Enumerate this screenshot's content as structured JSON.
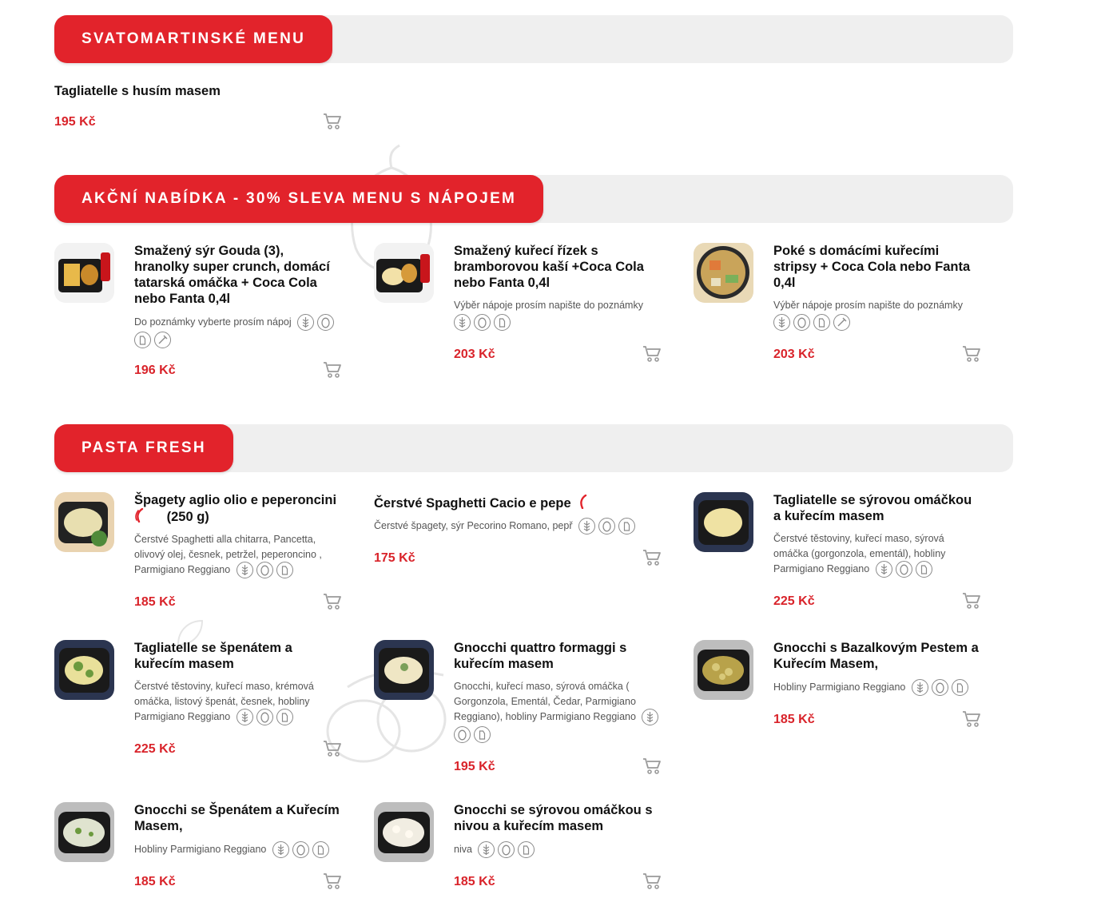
{
  "sections": [
    {
      "title": "SVATOMARTINSKÉ MENU",
      "items": [
        {
          "name": "Tagliatelle s husím masem",
          "price": "195 Kč",
          "image": false
        }
      ]
    },
    {
      "title": "AKČNÍ NABÍDKA - 30% SLEVA MENU S NÁPOJEM",
      "items": [
        {
          "name": "Smažený sýr Gouda (3), hranolky super crunch, domácí tatarská omáčka + Coca Cola nebo Fanta 0,4l",
          "desc": "Do poznámky vyberte prosím nápoj",
          "price": "196 Kč",
          "allergens": [
            "gluten-icon",
            "egg-icon",
            "milk-icon",
            "mustard-icon"
          ]
        },
        {
          "name": "Smažený kuřecí řízek s bramborovou kaší +Coca Cola nebo Fanta 0,4l",
          "desc": "Výběr nápoje prosím napište do poznámky",
          "price": "203 Kč",
          "allergens": [
            "gluten-icon",
            "egg-icon",
            "milk-icon"
          ]
        },
        {
          "name": "Poké s domácími kuřecími stripsy + Coca Cola nebo Fanta 0,4l",
          "desc": "Výběr nápoje prosím napište do poznámky",
          "price": "203 Kč",
          "allergens": [
            "gluten-icon",
            "egg-icon",
            "milk-icon",
            "mustard-icon"
          ]
        }
      ]
    },
    {
      "title": "PASTA FRESH",
      "items": [
        {
          "name": "Špagety aglio olio e peperoncini",
          "name_suffix": "(250 g)",
          "desc": "Čerstvé Spaghetti alla chitarra, Pancetta, olivový olej, česnek, petržel, peperoncino , Parmigiano Reggiano",
          "price": "185 Kč",
          "allergens": [
            "gluten-icon",
            "egg-icon",
            "milk-icon"
          ]
        },
        {
          "name": "Čerstvé Spaghetti Cacio e pepe",
          "desc": "Čerstvé špagety, sýr Pecorino Romano, pepř",
          "price": "175 Kč",
          "allergens": [
            "gluten-icon",
            "egg-icon",
            "milk-icon"
          ]
        },
        {
          "name": "Tagliatelle se sýrovou omáčkou a kuřecím masem",
          "desc": "Čerstvé těstoviny, kuřecí maso, sýrová omáčka (gorgonzola, ementál), hobliny Parmigiano Reggiano",
          "price": "225 Kč",
          "allergens": [
            "gluten-icon",
            "egg-icon",
            "milk-icon"
          ]
        },
        {
          "name": "Tagliatelle se špenátem a kuřecím masem",
          "desc": "Čerstvé těstoviny, kuřecí maso, krémová omáčka, listový špenát, česnek, hobliny Parmigiano Reggiano",
          "price": "225 Kč",
          "allergens": [
            "gluten-icon",
            "egg-icon",
            "milk-icon"
          ]
        },
        {
          "name": "Gnocchi quattro formaggi s kuřecím masem",
          "desc": "Gnocchi, kuřecí maso, sýrová omáčka ( Gorgonzola, Ementál, Čedar, Parmigiano Reggiano), hobliny Parmigiano Reggiano",
          "price": "195 Kč",
          "allergens": [
            "gluten-icon",
            "egg-icon",
            "milk-icon"
          ]
        },
        {
          "name": "Gnocchi s Bazalkovým Pestem a Kuřecím Masem,",
          "desc": "Hobliny Parmigiano Reggiano",
          "price": "185 Kč",
          "allergens": [
            "gluten-icon",
            "egg-icon",
            "milk-icon"
          ]
        },
        {
          "name": "Gnocchi se Špenátem a Kuřecím Masem,",
          "desc": "Hobliny Parmigiano Reggiano",
          "price": "185 Kč",
          "allergens": [
            "gluten-icon",
            "egg-icon",
            "milk-icon"
          ]
        },
        {
          "name": "Gnocchi se sýrovou omáčkou s nivou a kuřecím masem",
          "desc": "niva",
          "price": "185 Kč",
          "allergens": [
            "gluten-icon",
            "egg-icon",
            "milk-icon"
          ]
        }
      ]
    }
  ],
  "colors": {
    "accent": "#e2232b",
    "price": "#d9232a",
    "section_bg": "#efefef"
  },
  "icons": {
    "cart": "cart-icon",
    "spicy": "chili-icon"
  }
}
